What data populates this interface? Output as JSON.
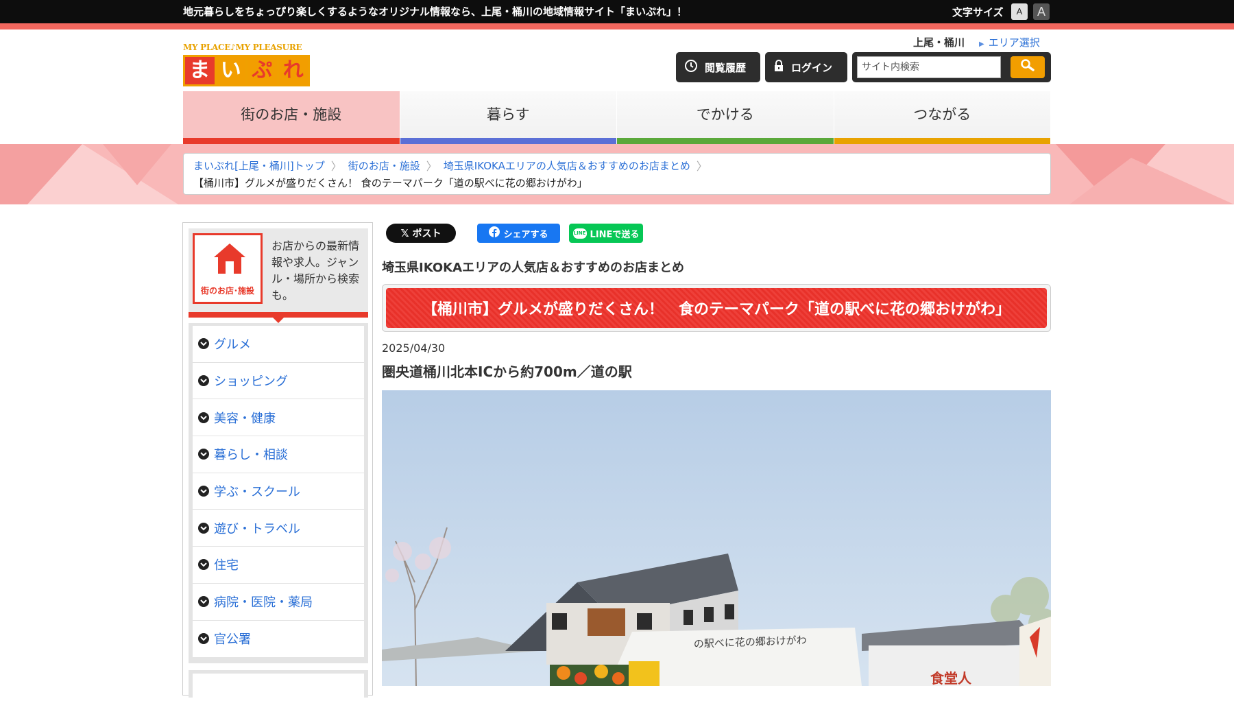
{
  "topbar": {
    "tagline": "地元暮らしをちょっぴり楽しくするようなオリジナル情報なら、上尾・桶川の地域情報サイト「まいぷれ」！",
    "font_size_label": "文字サイズ",
    "font_small": "A",
    "font_large": "A"
  },
  "logo": {
    "subtitle": "MY PLACE♪MY PLEASURE",
    "chars": [
      "ま",
      "い",
      "ぷ",
      "れ"
    ]
  },
  "header": {
    "area_name": "上尾・桶川",
    "area_select": "エリア選択",
    "history_label": "閲覧履歴",
    "login_label": "ログイン",
    "search_placeholder": "サイト内検索"
  },
  "nav": {
    "items": [
      {
        "label": "街のお店・施設",
        "color": "#e83a2b"
      },
      {
        "label": "暮らす",
        "color": "#5b6fd6"
      },
      {
        "label": "でかける",
        "color": "#5aa83a"
      },
      {
        "label": "つながる",
        "color": "#e8a200"
      }
    ]
  },
  "breadcrumb": {
    "items": [
      "まいぷれ[上尾・桶川]トップ",
      "街のお店・施設",
      "埼玉県IKOKAエリアの人気店＆おすすめのお店まとめ"
    ],
    "current": "【桶川市】グルメが盛りだくさん！ 食のテーマパーク「道の駅べに花の郷おけがわ」"
  },
  "sidebar": {
    "icon_label": "街のお店･施設",
    "description": "お店からの最新情報や求人。ジャンル・場所から検索も。",
    "items": [
      "グルメ",
      "ショッピング",
      "美容・健康",
      "暮らし・相談",
      "学ぶ・スクール",
      "遊び・トラベル",
      "住宅",
      "病院・医院・薬局",
      "官公署"
    ]
  },
  "share": {
    "x_label": "ポスト",
    "fb_label": "シェアする",
    "line_label": "LINEで送る",
    "line_icon": "LINE"
  },
  "article": {
    "category": "埼玉県IKOKAエリアの人気店＆おすすめのお店まとめ",
    "title": "【桶川市】グルメが盛りだくさん！　食のテーマパーク「道の駅べに花の郷おけがわ」",
    "date": "2025/04/30",
    "subtitle": "圏央道桶川北本ICから約700m／道の駅",
    "photo_sign": "の駅べに花の郷おけがわ",
    "photo_store": "食堂人"
  },
  "colors": {
    "accent_red": "#e83a2b",
    "link_blue": "#2a6fd6",
    "logo_orange": "#f29e00"
  }
}
